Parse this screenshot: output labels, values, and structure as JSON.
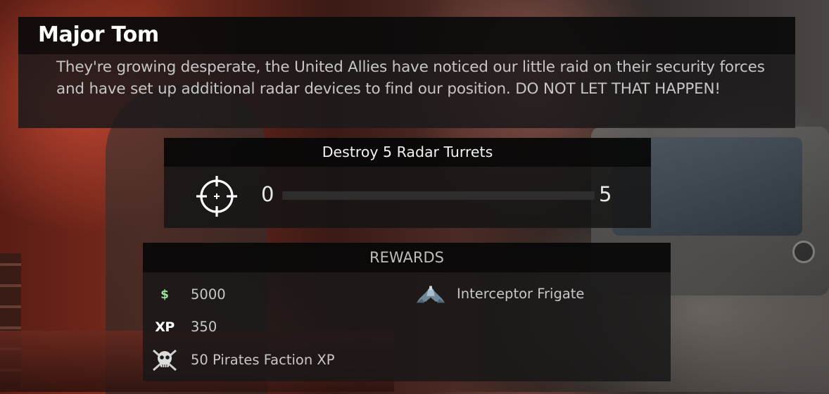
{
  "dialog": {
    "character_name": "Major Tom",
    "message": "They're growing desperate, the United Allies have noticed our little raid on their security forces and have set up additional radar devices to find our position. DO NOT LET THAT HAPPEN!"
  },
  "objective": {
    "title": "Destroy 5 Radar Turrets",
    "icon": "crosshair-target-icon",
    "progress_current": "0",
    "progress_total": "5",
    "progress_fraction": 0
  },
  "rewards": {
    "title": "REWARDS",
    "items": [
      {
        "icon": "dollar-icon",
        "icon_glyph": "$",
        "icon_color": "#9be29b",
        "label": "5000"
      },
      {
        "icon": "xp-icon",
        "icon_glyph": "XP",
        "label": "350"
      },
      {
        "icon": "pirate-skull-icon",
        "label": "50 Pirates Faction XP"
      },
      {
        "icon": "ship-frigate-icon",
        "label": "Interceptor Frigate"
      }
    ]
  }
}
